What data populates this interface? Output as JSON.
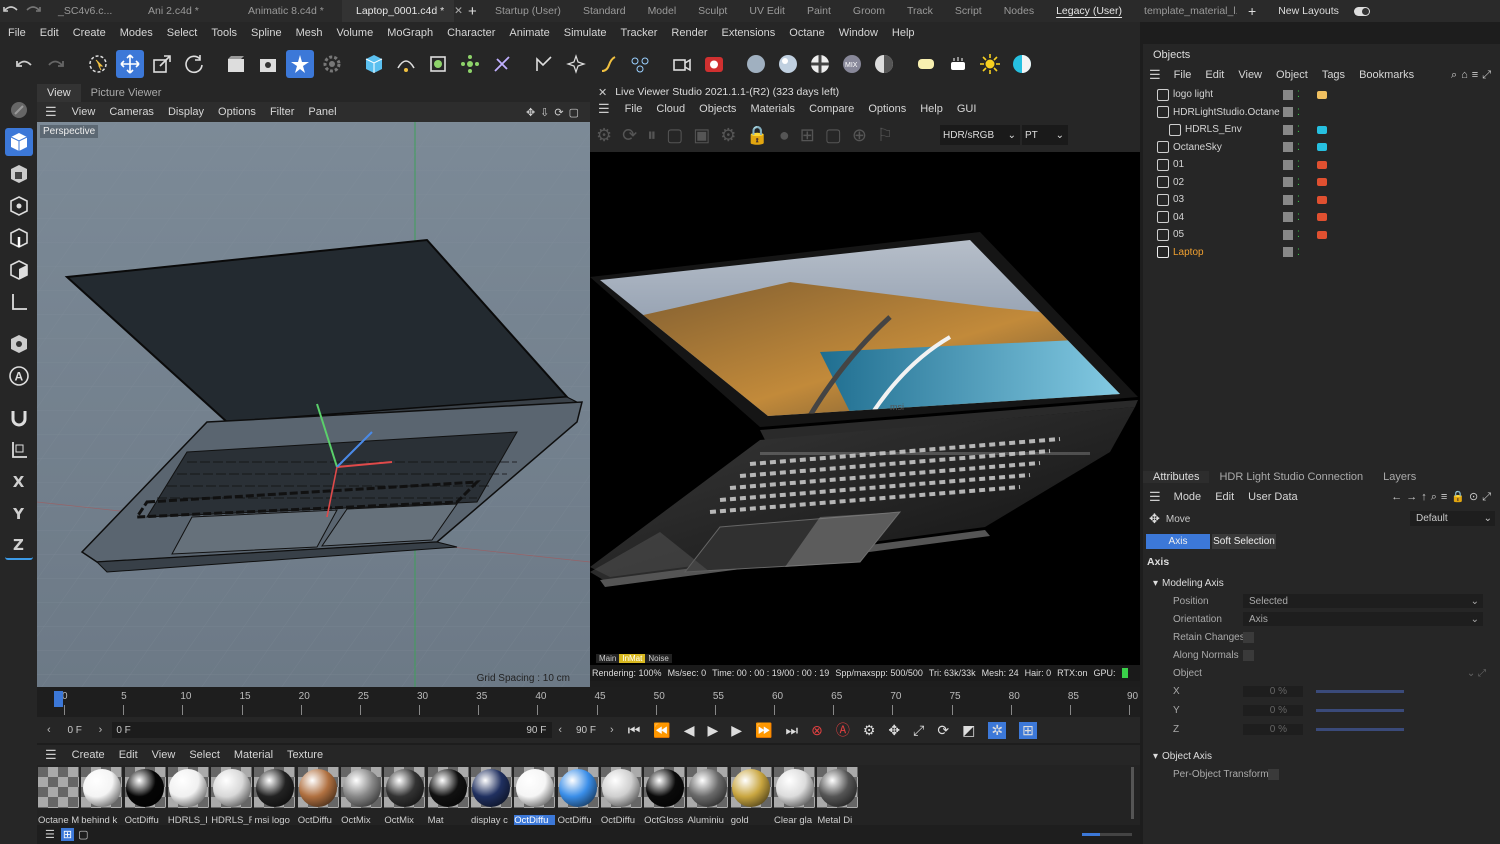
{
  "doc_tabs": [
    {
      "label": "_SC4v6.c...",
      "active": false
    },
    {
      "label": "Ani 2.c4d *",
      "active": false
    },
    {
      "label": "Animatic 8.c4d *",
      "active": false
    },
    {
      "label": "Laptop_0001.c4d *",
      "active": true
    }
  ],
  "layout_tabs": [
    {
      "label": "Startup (User)"
    },
    {
      "label": "Standard"
    },
    {
      "label": "Model"
    },
    {
      "label": "Sculpt"
    },
    {
      "label": "UV Edit"
    },
    {
      "label": "Paint"
    },
    {
      "label": "Groom"
    },
    {
      "label": "Track"
    },
    {
      "label": "Script"
    },
    {
      "label": "Nodes"
    },
    {
      "label": "Legacy (User)"
    },
    {
      "label": "template_material_l..."
    }
  ],
  "new_layouts_label": "New Layouts",
  "menu": [
    "File",
    "Edit",
    "Create",
    "Modes",
    "Select",
    "Tools",
    "Spline",
    "Mesh",
    "Volume",
    "MoGraph",
    "Character",
    "Animate",
    "Simulate",
    "Tracker",
    "Render",
    "Extensions",
    "Octane",
    "Window",
    "Help"
  ],
  "viewport": {
    "tabs": [
      "View",
      "Picture Viewer"
    ],
    "menu": [
      "View",
      "Cameras",
      "Display",
      "Options",
      "Filter",
      "Panel"
    ],
    "label": "Perspective",
    "grid_spacing": "Grid Spacing : 10 cm"
  },
  "live_viewer": {
    "title": "Live Viewer Studio 2021.1.1-(R2) (323 days left)",
    "menu": [
      "File",
      "Cloud",
      "Objects",
      "Materials",
      "Compare",
      "Options",
      "Help",
      "GUI"
    ],
    "color_mode": "HDR/sRGB",
    "pass": "PT",
    "render_tabs": [
      "Main",
      "InMat",
      "Noise"
    ],
    "status": {
      "rendering": "Rendering: 100%",
      "ms_sec": "Ms/sec: 0",
      "time": "Time: 00 : 00 : 19/00 : 00 : 19",
      "spp": "Spp/maxspp: 500/500",
      "tri": "Tri: 63k/33k",
      "mesh": "Mesh: 24",
      "hair": "Hair: 0",
      "rtx": "RTX:on",
      "gpu": "GPU:"
    },
    "logo_text": "msi"
  },
  "timeline": {
    "ticks": [
      "0",
      "5",
      "10",
      "15",
      "20",
      "25",
      "30",
      "35",
      "40",
      "45",
      "50",
      "55",
      "60",
      "65",
      "70",
      "75",
      "80",
      "85",
      "90"
    ]
  },
  "transport": {
    "start_frame": "0 F",
    "current_frame": "0 F",
    "end_frame_a": "90 F",
    "end_frame_b": "90 F"
  },
  "material_menu": [
    "Create",
    "Edit",
    "View",
    "Select",
    "Material",
    "Texture"
  ],
  "materials": [
    {
      "label": "Octane M",
      "color": "#e8e8e8",
      "checker": true
    },
    {
      "label": "behind k",
      "color": "#f4f4f4"
    },
    {
      "label": "OctDiffu",
      "color": "#050505"
    },
    {
      "label": "HDRLS_l",
      "color": "#f0f0f0"
    },
    {
      "label": "HDRLS_F",
      "color": "#d8d8d8"
    },
    {
      "label": "msi logo",
      "color": "#222"
    },
    {
      "label": "OctDiffu",
      "color": "#b07040"
    },
    {
      "label": "OctMix",
      "color": "#888"
    },
    {
      "label": "OctMix",
      "color": "#333"
    },
    {
      "label": "Mat",
      "color": "#111"
    },
    {
      "label": "display c",
      "color": "#203060"
    },
    {
      "label": "OctDiffu",
      "color": "#f5f5f5",
      "selected": true
    },
    {
      "label": "OctDiffu",
      "color": "#3a8ee8"
    },
    {
      "label": "OctDiffu",
      "color": "#cfcfcf"
    },
    {
      "label": "OctGloss",
      "color": "#0a0a0a"
    },
    {
      "label": "Aluminiu",
      "color": "#6a6a6a"
    },
    {
      "label": "gold",
      "color": "#c9a640"
    },
    {
      "label": "Clear gla",
      "color": "#dcdcdc"
    },
    {
      "label": "Metal Di",
      "color": "#555"
    }
  ],
  "objects_panel": {
    "title": "Objects",
    "menu": [
      "File",
      "Edit",
      "View",
      "Object",
      "Tags",
      "Bookmarks"
    ],
    "items": [
      {
        "name": "logo light",
        "indent": 0,
        "highlight": false
      },
      {
        "name": "HDRLightStudio.Octane",
        "indent": 0,
        "highlight": false
      },
      {
        "name": "HDRLS_Env",
        "indent": 1,
        "highlight": false
      },
      {
        "name": "OctaneSky",
        "indent": 0,
        "highlight": false
      },
      {
        "name": "01",
        "indent": 0,
        "highlight": false
      },
      {
        "name": "02",
        "indent": 0,
        "highlight": false
      },
      {
        "name": "03",
        "indent": 0,
        "highlight": false
      },
      {
        "name": "04",
        "indent": 0,
        "highlight": false
      },
      {
        "name": "05",
        "indent": 0,
        "highlight": false
      },
      {
        "name": "Laptop",
        "indent": 0,
        "highlight": true
      }
    ]
  },
  "attributes_panel": {
    "tabs": [
      "Attributes",
      "HDR Light Studio Connection",
      "Layers"
    ],
    "menu": [
      "Mode",
      "Edit",
      "User Data"
    ],
    "tool_name": "Move",
    "preset": "Default",
    "subtabs": [
      "Axis",
      "Soft Selection"
    ],
    "section": "Axis",
    "group1": "Modeling Axis",
    "position_label": "Position",
    "position_value": "Selected",
    "orientation_label": "Orientation",
    "orientation_value": "Axis",
    "retain_label": "Retain Changes",
    "normals_label": "Along Normals",
    "object_label": "Object",
    "x_label": "X",
    "y_label": "Y",
    "z_label": "Z",
    "x_value": "0 %",
    "y_value": "0 %",
    "z_value": "0 %",
    "group2": "Object Axis",
    "per_object_label": "Per-Object Transform"
  },
  "colors": {
    "accent": "#3c78d8",
    "highlight_text": "#f0a030",
    "record": "#e04040"
  }
}
